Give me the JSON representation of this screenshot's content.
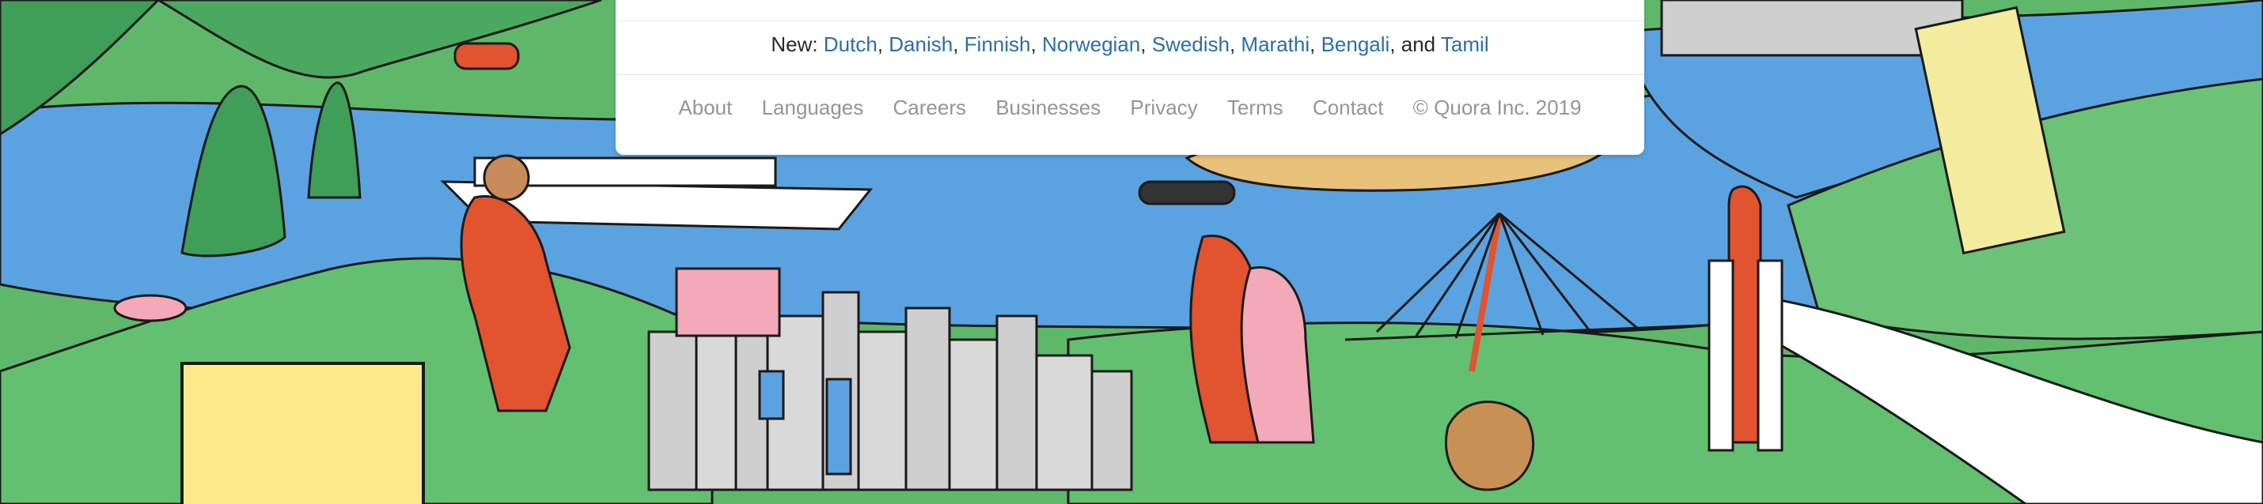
{
  "footer": {
    "new_prefix": "New:",
    "languages": [
      "Dutch",
      "Danish",
      "Finnish",
      "Norwegian",
      "Swedish",
      "Marathi",
      "Bengali",
      "Tamil"
    ],
    "and_word": "and",
    "links": [
      "About",
      "Languages",
      "Careers",
      "Businesses",
      "Privacy",
      "Terms",
      "Contact"
    ],
    "copyright": "© Quora Inc. 2019"
  },
  "colors": {
    "link_blue": "#2b6dad",
    "footer_gray": "#939598",
    "water_blue": "#5aa3e0",
    "grass_green": "#5fb86a"
  }
}
